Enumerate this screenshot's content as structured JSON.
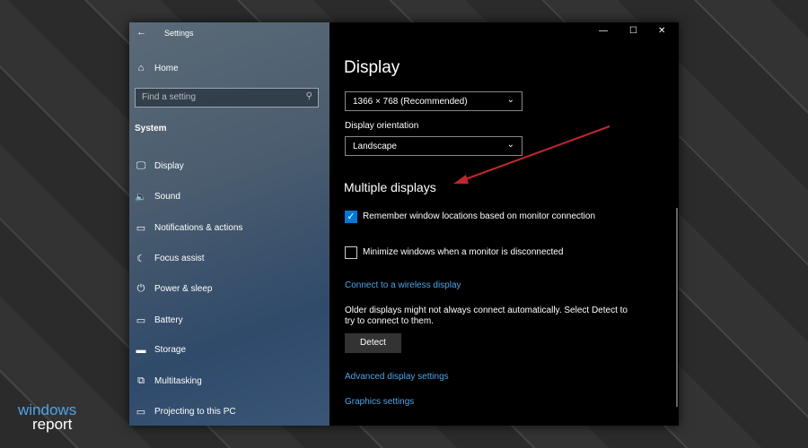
{
  "window": {
    "title": "Settings",
    "minimize": "—",
    "maximize": "☐",
    "close": "✕"
  },
  "sidebar": {
    "back": "←",
    "home": "Home",
    "search_placeholder": "Find a setting",
    "section": "System",
    "items": [
      {
        "label": "Display",
        "icon": "🖵"
      },
      {
        "label": "Sound",
        "icon": "🔈"
      },
      {
        "label": "Notifications & actions",
        "icon": "▭"
      },
      {
        "label": "Focus assist",
        "icon": "☾"
      },
      {
        "label": "Power & sleep",
        "icon": "⏻"
      },
      {
        "label": "Battery",
        "icon": "▭"
      },
      {
        "label": "Storage",
        "icon": "▬"
      },
      {
        "label": "Multitasking",
        "icon": "⧉"
      },
      {
        "label": "Projecting to this PC",
        "icon": "▭"
      }
    ]
  },
  "main": {
    "title": "Display",
    "resolution": "1366 × 768 (Recommended)",
    "orientation_label": "Display orientation",
    "orientation": "Landscape",
    "multi_heading": "Multiple displays",
    "remember": {
      "label": "Remember window locations based on monitor connection",
      "checked": true
    },
    "minimize": {
      "label": "Minimize windows when a monitor is disconnected",
      "checked": false
    },
    "wireless_link": "Connect to a wireless display",
    "older_text": "Older displays might not always connect automatically. Select Detect to try to connect to them.",
    "detect": "Detect",
    "advanced_link": "Advanced display settings",
    "graphics_link": "Graphics settings"
  },
  "brand": {
    "line1": "windows",
    "line2": "report"
  },
  "colors": {
    "accent": "#0078d7",
    "arrow": "#c0272d",
    "link": "#4ea3e8"
  }
}
